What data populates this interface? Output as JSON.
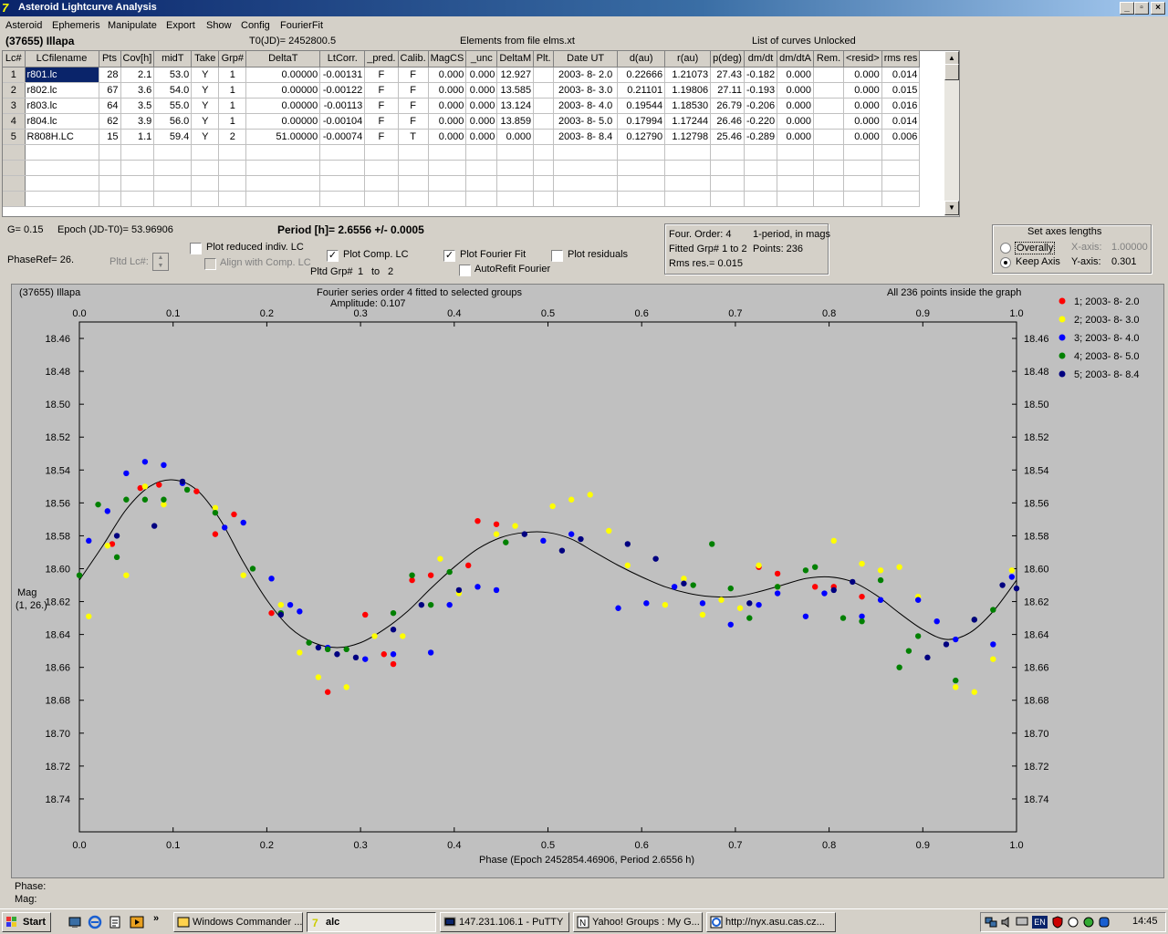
{
  "window": {
    "title": "Asteroid Lightcurve Analysis",
    "app_icon": "7"
  },
  "caption_buttons": {
    "minimize": "_",
    "restore": "▫",
    "close": "×"
  },
  "menu": [
    "Asteroid",
    "Ephemeris",
    "Manipulate",
    "Export",
    "Show",
    "Config",
    "FourierFit"
  ],
  "header": {
    "object": "(37655) Illapa",
    "t0": "T0(JD)= 2452800.5",
    "elements": "Elements from file elms.xt",
    "curves": "List of curves Unlocked"
  },
  "grid": {
    "columns": [
      "Lc#",
      "LCfilename",
      "Pts",
      "Cov[h]",
      "midT",
      "Take",
      "Grp#",
      "DeltaT",
      "LtCorr.",
      "_pred.",
      "Calib.",
      "MagCS",
      "_unc",
      "DeltaM",
      "Plt.",
      "Date UT",
      "d(au)",
      "r(au)",
      "p(deg)",
      "dm/dt",
      "dm/dtA",
      "Rem.",
      "<resid>",
      "rms res"
    ],
    "rows": [
      [
        "1",
        "r801.lc",
        "28",
        "2.1",
        "53.0",
        "Y",
        "1",
        "0.00000",
        "-0.00131",
        "F",
        "F",
        "0.000",
        "0.000",
        "12.927",
        "",
        "2003- 8- 2.0",
        "0.22666",
        "1.21073",
        "27.43",
        "-0.182",
        "0.000",
        "",
        "0.000",
        "0.014"
      ],
      [
        "2",
        "r802.lc",
        "67",
        "3.6",
        "54.0",
        "Y",
        "1",
        "0.00000",
        "-0.00122",
        "F",
        "F",
        "0.000",
        "0.000",
        "13.585",
        "",
        "2003- 8- 3.0",
        "0.21101",
        "1.19806",
        "27.11",
        "-0.193",
        "0.000",
        "",
        "0.000",
        "0.015"
      ],
      [
        "3",
        "r803.lc",
        "64",
        "3.5",
        "55.0",
        "Y",
        "1",
        "0.00000",
        "-0.00113",
        "F",
        "F",
        "0.000",
        "0.000",
        "13.124",
        "",
        "2003- 8- 4.0",
        "0.19544",
        "1.18530",
        "26.79",
        "-0.206",
        "0.000",
        "",
        "0.000",
        "0.016"
      ],
      [
        "4",
        "r804.lc",
        "62",
        "3.9",
        "56.0",
        "Y",
        "1",
        "0.00000",
        "-0.00104",
        "F",
        "F",
        "0.000",
        "0.000",
        "13.859",
        "",
        "2003- 8- 5.0",
        "0.17994",
        "1.17244",
        "26.46",
        "-0.220",
        "0.000",
        "",
        "0.000",
        "0.014"
      ],
      [
        "5",
        "R808H.LC",
        "15",
        "1.1",
        "59.4",
        "Y",
        "2",
        "51.00000",
        "-0.00074",
        "F",
        "T",
        "0.000",
        "0.000",
        "0.000",
        "",
        "2003- 8- 8.4",
        "0.12790",
        "1.12798",
        "25.46",
        "-0.289",
        "0.000",
        "",
        "0.000",
        "0.006"
      ]
    ],
    "empty_rows": 4,
    "selected": "r801.lc"
  },
  "controls": {
    "g": "G= 0.15",
    "epoch": "Epoch (JD-T0)= 53.96906",
    "period": "Period [h]= 2.6556 +/- 0.0005",
    "phaseref": "PhaseRef= 26.",
    "pltd_lc": "Pltd Lc#:",
    "plot_reduced": "Plot reduced indiv. LC",
    "align_comp": "Align with Comp. LC",
    "plot_comp": "Plot Comp. LC",
    "pltd_grp": "Pltd Grp#",
    "grp_from": "1",
    "grp_to_label": "to",
    "grp_to": "2",
    "plot_fourier": "Plot Fourier Fit",
    "autorefit": "AutoRefit Fourier",
    "plot_residuals": "Plot residuals",
    "checked": {
      "plot_reduced": false,
      "align_comp": false,
      "plot_comp": true,
      "plot_fourier": true,
      "autorefit": false,
      "plot_residuals": false
    }
  },
  "fourier_info": {
    "order": "Four. Order:  4",
    "mode": "1-period, in mags",
    "fitted": "Fitted Grp# 1 to 2",
    "points": "Points: 236",
    "rms": "Rms res.= 0.015"
  },
  "axes_box": {
    "title": "Set axes lengths",
    "overally": "Overally",
    "keep_axis": "Keep Axis",
    "x_axis_label": "X-axis:",
    "x_axis_value": "1.00000",
    "y_axis_label": "Y-axis:",
    "y_axis_value": "0.301",
    "selected": "keep_axis"
  },
  "chart_data": {
    "type": "scatter",
    "title": "Fourier series order 4 fitted to selected groups",
    "subtitle": "Amplitude: 0.107",
    "object_label": "(37655) Illapa",
    "points_note": "All 236 points inside the graph",
    "xlabel": "Phase (Epoch 2452854.46906, Period 2.6556 h)",
    "ylabel": "Mag",
    "ylabel_sub": "(1, 26.)",
    "xlim": [
      0.0,
      1.0
    ],
    "ylim": [
      18.45,
      18.76
    ],
    "y_inverted": true,
    "x_ticks": [
      "0.0",
      "0.1",
      "0.2",
      "0.3",
      "0.4",
      "0.5",
      "0.6",
      "0.7",
      "0.8",
      "0.9",
      "1.0"
    ],
    "y_ticks": [
      "18.46",
      "18.48",
      "18.50",
      "18.52",
      "18.54",
      "18.56",
      "18.58",
      "18.60",
      "18.62",
      "18.64",
      "18.66",
      "18.68",
      "18.70",
      "18.72",
      "18.74"
    ],
    "fit_curve": {
      "x": [
        0.0,
        0.025,
        0.05,
        0.075,
        0.1,
        0.125,
        0.15,
        0.175,
        0.2,
        0.225,
        0.25,
        0.275,
        0.3,
        0.325,
        0.35,
        0.375,
        0.4,
        0.425,
        0.45,
        0.475,
        0.5,
        0.525,
        0.55,
        0.575,
        0.6,
        0.625,
        0.65,
        0.675,
        0.7,
        0.725,
        0.75,
        0.775,
        0.8,
        0.825,
        0.85,
        0.875,
        0.9,
        0.925,
        0.95,
        0.975,
        1.0
      ],
      "y": [
        18.607,
        18.586,
        18.564,
        18.55,
        18.546,
        18.552,
        18.57,
        18.596,
        18.619,
        18.636,
        18.645,
        18.648,
        18.645,
        18.637,
        18.626,
        18.612,
        18.599,
        18.588,
        18.581,
        18.578,
        18.578,
        18.582,
        18.59,
        18.598,
        18.605,
        18.611,
        18.615,
        18.617,
        18.617,
        18.614,
        18.61,
        18.606,
        18.605,
        18.608,
        18.616,
        18.627,
        18.637,
        18.643,
        18.639,
        18.626,
        18.607
      ]
    },
    "legend": {
      "placement": "top-right"
    },
    "series": [
      {
        "name": "1; 2003- 8- 2.0",
        "color": "#ff0000",
        "x": [
          0.035,
          0.065,
          0.085,
          0.125,
          0.145,
          0.165,
          0.205,
          0.265,
          0.305,
          0.325,
          0.335,
          0.355,
          0.375,
          0.415,
          0.425,
          0.445,
          0.725,
          0.745,
          0.785,
          0.805,
          0.835
        ],
        "y": [
          18.585,
          18.551,
          18.549,
          18.553,
          18.579,
          18.567,
          18.627,
          18.675,
          18.628,
          18.652,
          18.658,
          18.607,
          18.604,
          18.598,
          18.571,
          18.573,
          18.599,
          18.603,
          18.611,
          18.611,
          18.617
        ]
      },
      {
        "name": "2; 2003- 8- 3.0",
        "color": "#ffff00",
        "x": [
          0.01,
          0.03,
          0.05,
          0.07,
          0.09,
          0.145,
          0.175,
          0.215,
          0.235,
          0.255,
          0.285,
          0.315,
          0.345,
          0.385,
          0.405,
          0.445,
          0.465,
          0.505,
          0.525,
          0.545,
          0.565,
          0.585,
          0.625,
          0.645,
          0.665,
          0.685,
          0.705,
          0.725,
          0.745,
          0.805,
          0.835,
          0.855,
          0.875,
          0.895,
          0.935,
          0.955,
          0.975,
          0.995
        ],
        "y": [
          18.629,
          18.586,
          18.604,
          18.55,
          18.561,
          18.563,
          18.604,
          18.622,
          18.651,
          18.666,
          18.672,
          18.641,
          18.641,
          18.594,
          18.615,
          18.579,
          18.574,
          18.562,
          18.558,
          18.555,
          18.577,
          18.598,
          18.622,
          18.606,
          18.628,
          18.619,
          18.624,
          18.598,
          18.611,
          18.583,
          18.597,
          18.601,
          18.599,
          18.617,
          18.672,
          18.675,
          18.655,
          18.601
        ]
      },
      {
        "name": "3; 2003- 8- 4.0",
        "color": "#0000ff",
        "x": [
          0.01,
          0.03,
          0.05,
          0.07,
          0.09,
          0.11,
          0.155,
          0.175,
          0.205,
          0.225,
          0.235,
          0.265,
          0.305,
          0.335,
          0.375,
          0.395,
          0.425,
          0.445,
          0.495,
          0.525,
          0.575,
          0.605,
          0.635,
          0.665,
          0.695,
          0.725,
          0.745,
          0.775,
          0.795,
          0.835,
          0.855,
          0.895,
          0.915,
          0.935,
          0.975,
          0.995
        ],
        "y": [
          18.583,
          18.565,
          18.542,
          18.535,
          18.537,
          18.548,
          18.575,
          18.572,
          18.606,
          18.622,
          18.626,
          18.648,
          18.655,
          18.652,
          18.651,
          18.622,
          18.611,
          18.613,
          18.583,
          18.579,
          18.624,
          18.621,
          18.611,
          18.621,
          18.634,
          18.622,
          18.615,
          18.629,
          18.615,
          18.629,
          18.619,
          18.619,
          18.632,
          18.643,
          18.646,
          18.605
        ]
      },
      {
        "name": "4; 2003- 8- 5.0",
        "color": "#008000",
        "x": [
          0.0,
          0.02,
          0.04,
          0.05,
          0.07,
          0.09,
          0.115,
          0.145,
          0.185,
          0.215,
          0.245,
          0.265,
          0.285,
          0.335,
          0.355,
          0.375,
          0.395,
          0.455,
          0.655,
          0.675,
          0.695,
          0.715,
          0.745,
          0.775,
          0.785,
          0.815,
          0.835,
          0.855,
          0.875,
          0.885,
          0.895,
          0.935,
          0.955,
          0.975
        ],
        "y": [
          18.604,
          18.561,
          18.593,
          18.558,
          18.558,
          18.558,
          18.552,
          18.566,
          18.6,
          18.627,
          18.645,
          18.649,
          18.649,
          18.627,
          18.604,
          18.622,
          18.602,
          18.584,
          18.61,
          18.585,
          18.612,
          18.63,
          18.611,
          18.601,
          18.599,
          18.63,
          18.632,
          18.607,
          18.66,
          18.65,
          18.641,
          18.668,
          18.631,
          18.625
        ]
      },
      {
        "name": "5; 2003- 8- 8.4",
        "color": "#000080",
        "x": [
          0.04,
          0.08,
          0.11,
          0.215,
          0.255,
          0.275,
          0.295,
          0.335,
          0.365,
          0.405,
          0.475,
          0.515,
          0.535,
          0.585,
          0.615,
          0.645,
          0.715,
          0.805,
          0.825,
          0.905,
          0.925,
          0.955,
          0.985,
          1.0
        ],
        "y": [
          18.58,
          18.574,
          18.547,
          18.628,
          18.648,
          18.652,
          18.654,
          18.637,
          18.622,
          18.613,
          18.579,
          18.589,
          18.582,
          18.585,
          18.594,
          18.609,
          18.621,
          18.613,
          18.608,
          18.654,
          18.646,
          18.631,
          18.61,
          18.612
        ]
      }
    ]
  },
  "footer": {
    "phase": "Phase:",
    "mag": "Mag:"
  },
  "taskbar": {
    "start": "Start",
    "buttons": [
      "Windows Commander ...",
      "alc",
      "147.231.106.1 - PuTTY",
      "Yahoo! Groups : My G...",
      "http://nyx.asu.cas.cz..."
    ],
    "active": "alc",
    "chevron": "»",
    "lang": "EN",
    "clock": "14:45"
  }
}
